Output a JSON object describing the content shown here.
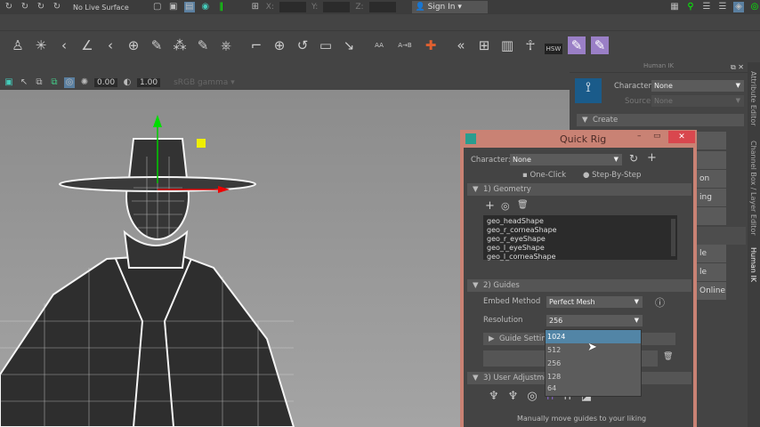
{
  "topbar": {
    "live_surface": "No Live Surface",
    "x_label": "X:",
    "y_label": "Y:",
    "z_label": "Z:",
    "sign_in": "Sign In"
  },
  "viewport_toolbar": {
    "exposure": "0.00",
    "gamma": "1.00",
    "color_space": "sRGB gamma"
  },
  "shelf": {
    "aa_label": "AA",
    "ab_label": "A→B",
    "hsw_label": "HSW"
  },
  "human_ik": {
    "title": "Human IK",
    "character_label": "Character:",
    "character_value": "None",
    "source_label": "Source:",
    "source_value": "None",
    "create_section": "Create",
    "partial_buttons": [
      "on",
      "ing",
      "le",
      "le",
      "Online"
    ]
  },
  "side_tabs": [
    "Attribute Editor",
    "Channel Box / Layer Editor",
    "Human IK"
  ],
  "quick_rig": {
    "title": "Quick Rig",
    "character_label": "Character:",
    "character_value": "None",
    "mode_one_click": "One-Click",
    "mode_step": "Step-By-Step",
    "geometry_section": "1) Geometry",
    "geometry_list": [
      "geo_headShape",
      "geo_r_corneaShape",
      "geo_r_eyeShape",
      "geo_l_eyeShape",
      "geo_l_corneaShape"
    ],
    "guides_section": "2) Guides",
    "embed_label": "Embed Method",
    "embed_value": "Perfect Mesh",
    "resolution_label": "Resolution",
    "resolution_value": "256",
    "guide_settings": "Guide Settings",
    "user_adjust_section": "3) User Adjustment",
    "hint": "Manually move guides to your liking",
    "resolution_options": [
      "1024",
      "512",
      "256",
      "128",
      "64"
    ],
    "selected_option": "1024"
  }
}
